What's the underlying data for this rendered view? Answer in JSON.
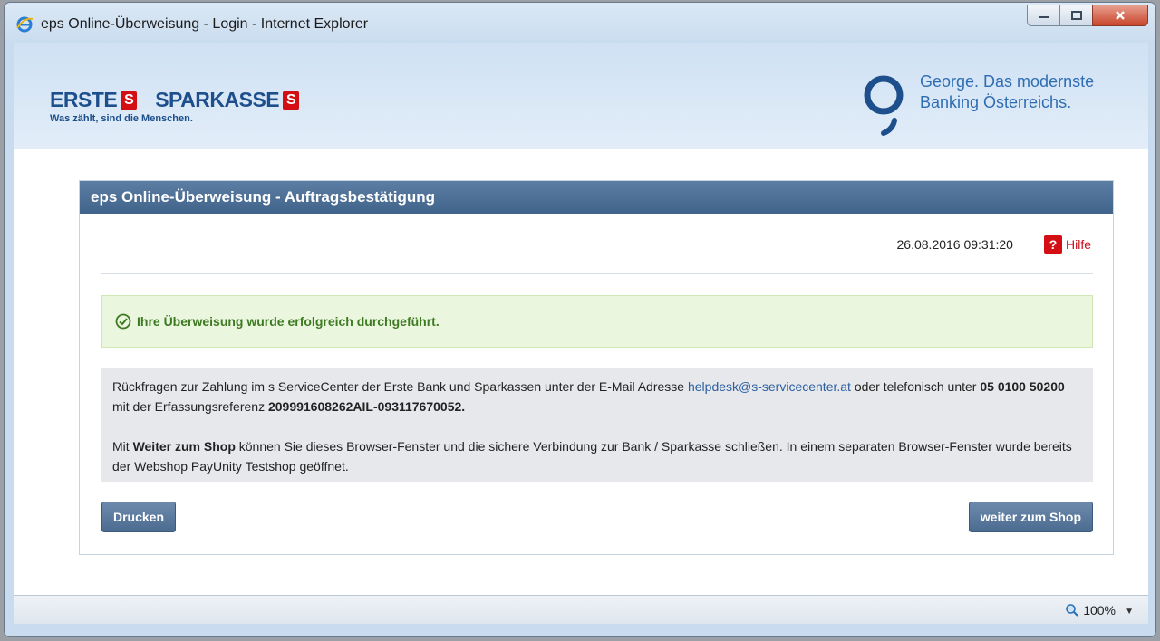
{
  "window": {
    "title": "eps Online-Überweisung - Login - Internet Explorer"
  },
  "banner": {
    "logo_erste": "ERSTE",
    "logo_sparkasse": "SPARKASSE",
    "logo_tagline": "Was zählt, sind die Menschen.",
    "george_line1": "George. Das modernste",
    "george_line2": "Banking Österreichs."
  },
  "panel": {
    "heading": "eps Online-Überweisung - Auftragsbestätigung",
    "datetime": "26.08.2016 09:31:20",
    "help_label": "Hilfe",
    "success_message": "Ihre Überweisung wurde erfolgreich durchgeführt.",
    "info": {
      "p1_a": "Rückfragen zur Zahlung im s ServiceCenter der Erste Bank und Sparkassen unter der E-Mail Adresse ",
      "email": "helpdesk@s-servicecenter.at",
      "p1_b": " oder telefonisch unter ",
      "phone": "05 0100 50200",
      "p1_c": " mit der Erfassungsreferenz ",
      "reference": "209991608262AIL-093117670052.",
      "p2_a": "Mit ",
      "p2_bold": "Weiter zum Shop",
      "p2_b": " können Sie dieses Browser-Fenster und die sichere Verbindung zur Bank / Sparkasse schließen. In einem separaten Browser-Fenster wurde bereits der Webshop PayUnity Testshop geöffnet."
    },
    "print_button": "Drucken",
    "shop_button": "weiter zum Shop"
  },
  "statusbar": {
    "zoom": "100%"
  },
  "colors": {
    "header_blue": "#40638b",
    "success_green": "#3e7a22",
    "sparkasse_red": "#d40f14"
  }
}
